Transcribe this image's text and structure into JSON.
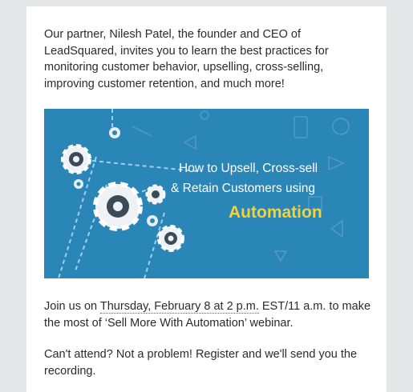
{
  "email": {
    "intro": "Our partner, Nilesh Patel, the founder and CEO of LeadSquared, invites you to learn the best practices for monitoring customer behavior, upselling, cross-selling, improving customer retention, and much more!",
    "banner": {
      "line1": "How to Upsell, Cross-sell",
      "line2": "& Retain Customers using",
      "line3": "Automation",
      "bg_color": "#2b86b8",
      "accent_color": "#f2d23a"
    },
    "join_prefix": "Join us on ",
    "join_date": "Thursday, February 8 at 2 p.m.",
    "join_suffix": " EST/11 a.m. to make the most of ‘Sell More With Automation’ webinar.",
    "cant_attend": "Can't attend? Not a problem! Register and we'll send you the recording."
  }
}
